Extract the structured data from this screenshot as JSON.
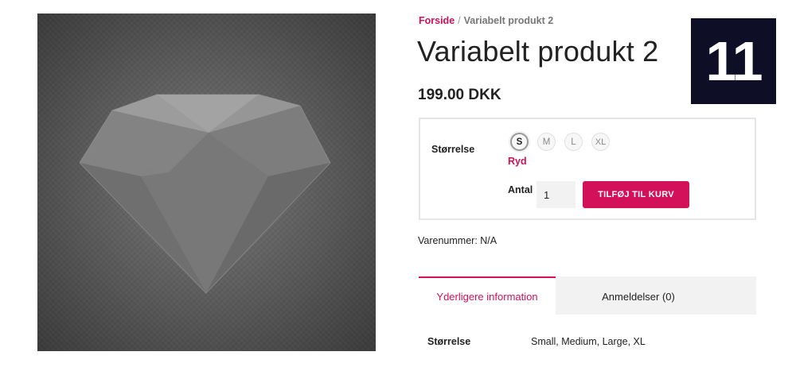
{
  "breadcrumb": {
    "home": "Forside",
    "separator": "/",
    "current": "Variabelt produkt 2"
  },
  "product": {
    "title": "Variabelt produkt 2",
    "price": "199.00 DKK",
    "image_icon": "diamond-placeholder"
  },
  "badge": {
    "number": "11",
    "background": "#0e0f26"
  },
  "variations": {
    "label": "Størrelse",
    "options": [
      "S",
      "M",
      "L",
      "XL"
    ],
    "selected": "S",
    "reset_label": "Ryd"
  },
  "cart": {
    "quantity_label": "Antal",
    "quantity_value": "1",
    "add_button_label": "TILFØJ TIL KURV"
  },
  "meta": {
    "sku_label": "Varenummer:",
    "sku_value": "N/A"
  },
  "tabs": [
    {
      "label": "Yderligere information",
      "active": true
    },
    {
      "label": "Anmeldelser (0)",
      "active": false
    }
  ],
  "additional_info": {
    "attribute_name": "Størrelse",
    "attribute_value": "Small, Medium, Large, XL"
  },
  "colors": {
    "accent": "#d3105a",
    "text": "#222222",
    "muted": "#777777"
  }
}
